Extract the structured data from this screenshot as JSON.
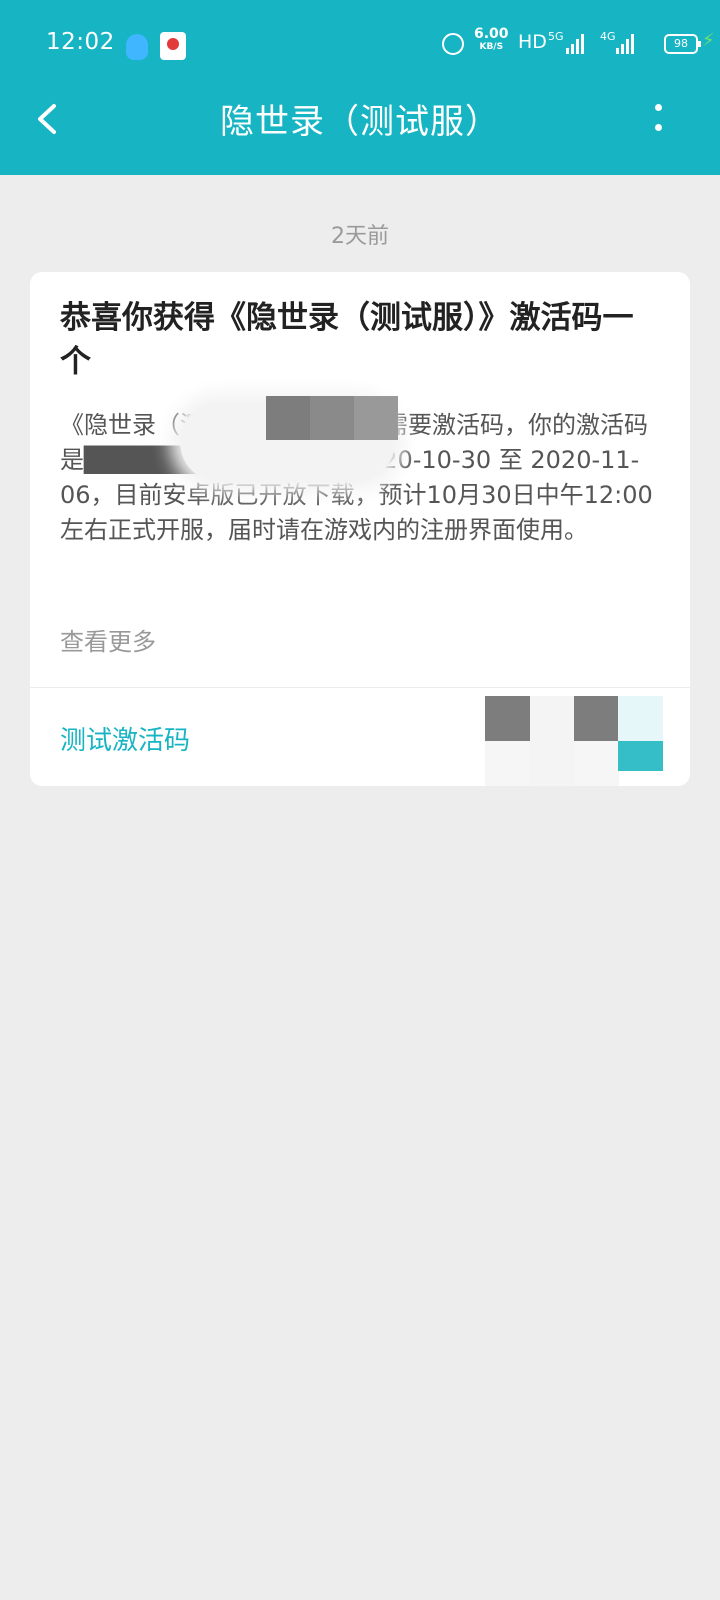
{
  "status_bar": {
    "time": "12:02",
    "speed_value": "6.00",
    "speed_unit": "KB/S",
    "hd": "HD",
    "sig1": "5G",
    "sig2": "4G",
    "battery": "98",
    "colors": {
      "battery_charge": "#6ee06e",
      "qq_icon": "#3fb6ff",
      "app_icon": "#e23a3a"
    }
  },
  "header": {
    "title": "隐世录（测试服）",
    "background": "#17b5c4",
    "icons": [
      "back-arrow-icon",
      "more-options-icon"
    ]
  },
  "message": {
    "time": "2天前",
    "title": "恭喜你获得《隐世录（测试服）》激活码一个",
    "body": "《隐世录（测试服）》删档测试需要激活码，你的激活码是████████，有效期：2020-10-30 至 2020-11-06，目前安卓版已开放下载，预计10月30日中午12:00左右正式开服，届时请在游戏内的注册界面使用。",
    "view_more": "查看更多",
    "code_label": "测试激活码",
    "accent": "#17b5c4"
  }
}
